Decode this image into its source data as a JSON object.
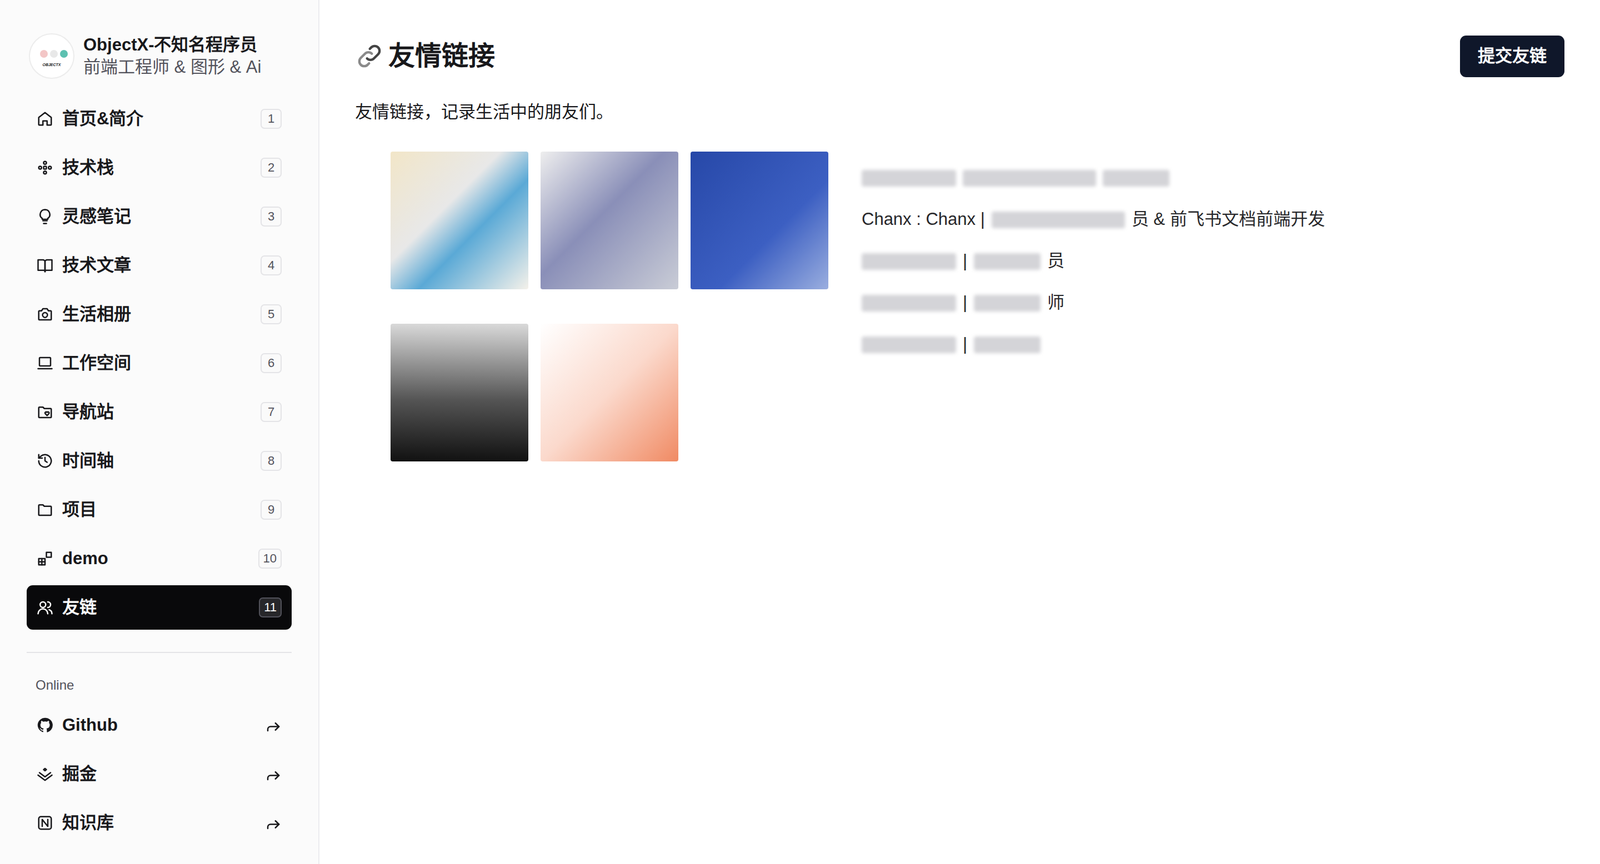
{
  "profile": {
    "logo": "OBJECTX",
    "name": "ObjectX-不知名程序员",
    "subtitle": "前端工程师 & 图形 & Ai"
  },
  "nav": [
    {
      "label": "首页&简介",
      "count": "1",
      "selected": false
    },
    {
      "label": "技术栈",
      "count": "2",
      "selected": false
    },
    {
      "label": "灵感笔记",
      "count": "3",
      "selected": false
    },
    {
      "label": "技术文章",
      "count": "4",
      "selected": false
    },
    {
      "label": "生活相册",
      "count": "5",
      "selected": false
    },
    {
      "label": "工作空间",
      "count": "6",
      "selected": false
    },
    {
      "label": "导航站",
      "count": "7",
      "selected": false
    },
    {
      "label": "时间轴",
      "count": "8",
      "selected": false
    },
    {
      "label": "项目",
      "count": "9",
      "selected": false
    },
    {
      "label": "demo",
      "count": "10",
      "selected": false
    },
    {
      "label": "友链",
      "count": "11",
      "selected": true
    }
  ],
  "online": {
    "heading": "Online",
    "links": [
      {
        "label": "Github"
      },
      {
        "label": "掘金"
      },
      {
        "label": "知识库"
      }
    ]
  },
  "page": {
    "title": "友情链接",
    "submit": "提交友链",
    "description": "友情链接，记录生活中的朋友们。"
  },
  "friends": {
    "avatars": [
      {
        "kind": "photo"
      },
      {
        "kind": "photo"
      },
      {
        "kind": "photo"
      },
      {
        "kind": "photo"
      },
      {
        "kind": "photo"
      }
    ],
    "lines": [
      [
        {
          "kind": "blur"
        },
        {
          "kind": "blur"
        },
        {
          "kind": "blur"
        }
      ],
      [
        {
          "kind": "text",
          "text": "Chanx : Chanx |"
        },
        {
          "kind": "blur"
        },
        {
          "kind": "text",
          "text": "员 & 前飞书文档前端开发"
        }
      ],
      [
        {
          "kind": "blur"
        },
        {
          "kind": "text",
          "text": "|"
        },
        {
          "kind": "blur"
        },
        {
          "kind": "text",
          "text": "员"
        }
      ],
      [
        {
          "kind": "blur"
        },
        {
          "kind": "text",
          "text": "|"
        },
        {
          "kind": "blur"
        },
        {
          "kind": "text",
          "text": "师"
        }
      ],
      [
        {
          "kind": "blur"
        },
        {
          "kind": "text",
          "text": "|"
        },
        {
          "kind": "blur"
        }
      ]
    ]
  }
}
